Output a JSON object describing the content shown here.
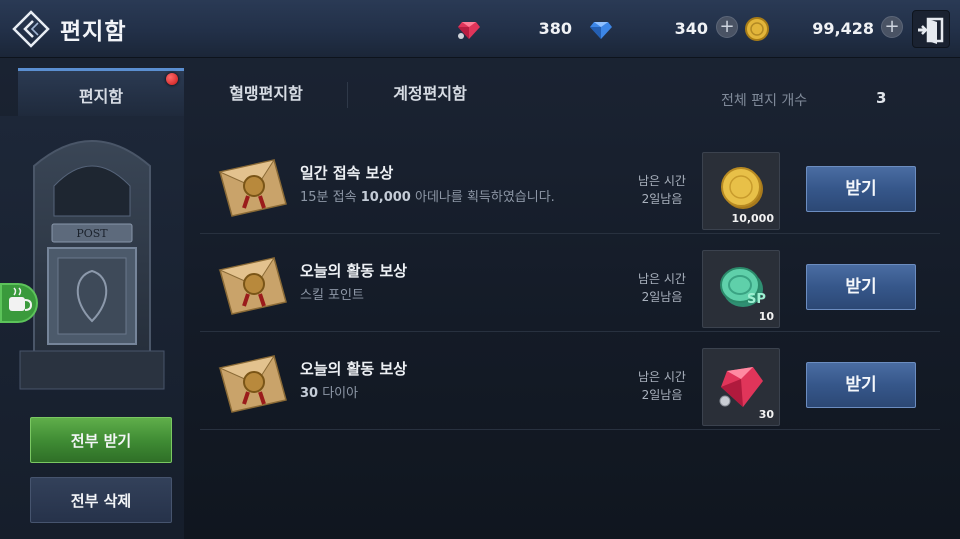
{
  "header": {
    "title": "편지함",
    "back_icon": "back-diamond-icon",
    "currencies": [
      {
        "icon": "red-diamond-icon",
        "amount": "380",
        "color": "#e0355a"
      },
      {
        "icon": "blue-diamond-icon",
        "amount": "340",
        "color": "#3d86e6"
      },
      {
        "icon": "gold-coin-icon",
        "amount": "99,428",
        "color": "#e2b53a"
      }
    ],
    "plus_label": "+",
    "exit_icon": "exit-door-icon"
  },
  "tabs": [
    {
      "label": "편지함",
      "active": true,
      "has_notification": true
    },
    {
      "label": "혈맹편지함",
      "active": false
    },
    {
      "label": "계정편지함",
      "active": false
    }
  ],
  "summary": {
    "total_label": "전체 편지 개수",
    "total_count": "3"
  },
  "left_panel": {
    "post_sign": "POST",
    "receive_all_label": "전부 받기",
    "delete_all_label": "전부 삭제"
  },
  "mails": [
    {
      "title": "일간 접속 보상",
      "desc_prefix": "15분 접속 ",
      "desc_highlight": "10,000",
      "desc_suffix": " 아데나를 획득하였습니다.",
      "time_label": "남은 시간",
      "time_value": "2일남음",
      "reward_icon": "gold-coin-icon",
      "reward_qty": "10,000",
      "button_label": "받기"
    },
    {
      "title": "오늘의 활동 보상",
      "desc_prefix": "스킬 포인트",
      "desc_highlight": "",
      "desc_suffix": "",
      "time_label": "남은 시간",
      "time_value": "2일남음",
      "reward_icon": "skill-point-coin-icon",
      "reward_qty": "10",
      "reward_text": "SP",
      "button_label": "받기"
    },
    {
      "title": "오늘의 활동 보상",
      "desc_prefix": "",
      "desc_highlight": "30",
      "desc_suffix": " 다이아",
      "time_label": "남은 시간",
      "time_value": "2일남음",
      "reward_icon": "red-diamond-icon",
      "reward_qty": "30",
      "button_label": "받기"
    }
  ],
  "colors": {
    "accent_blue": "#5b8fd1",
    "receive_button": "#36578a",
    "receive_all_button": "#3e8a33"
  }
}
